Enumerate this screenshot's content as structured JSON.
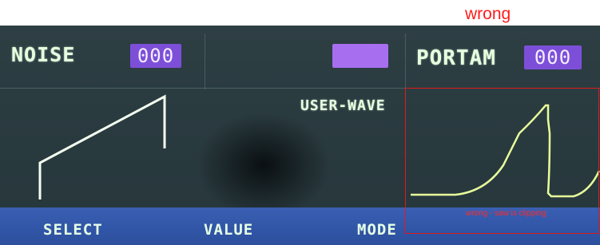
{
  "annotations": {
    "top_label": "wrong",
    "inner_label": "wrong - saw is clipping"
  },
  "header": {
    "noise_label": "NOISE",
    "noise_value": "000",
    "portam_label": "PORTAM",
    "portam_value": "000"
  },
  "waveforms": {
    "user_wave_label": "USER-WAVE"
  },
  "bottom_bar": {
    "select_label": "SELECT",
    "value_label": "VALUE",
    "mode_label": "MODE"
  },
  "colors": {
    "annotation_red": "#ff1b1b",
    "value_box": "#7d4fd9",
    "wave_line": "#e9ff9a",
    "bottom_bar": "#3457aa"
  }
}
